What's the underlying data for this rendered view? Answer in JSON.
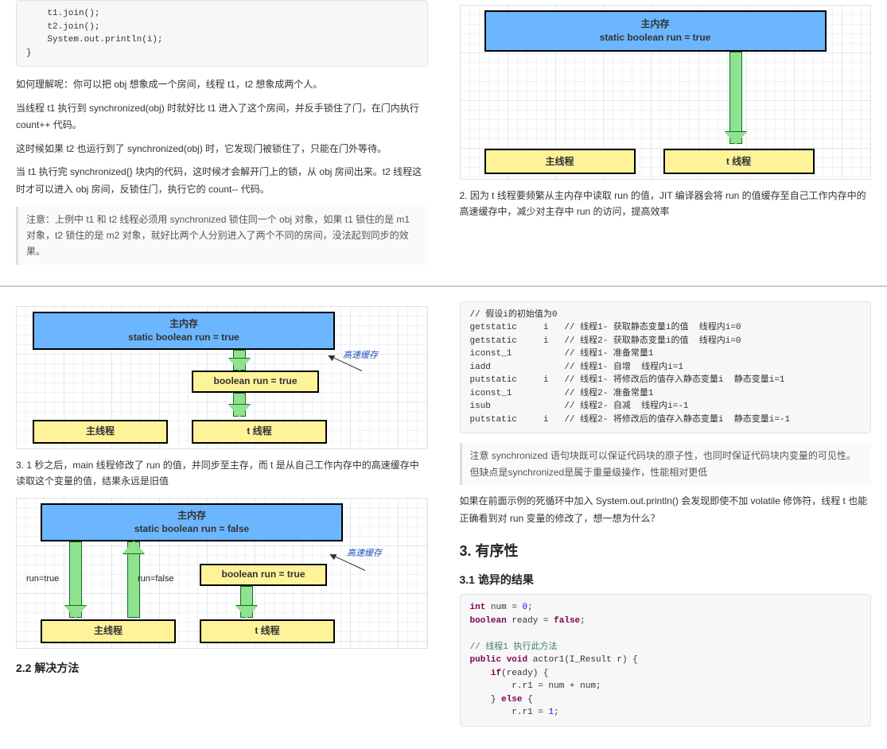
{
  "topLeft": {
    "code": "    t1.join();\n    t2.join();\n    System.out.println(i);\n}",
    "p1": "如何理解呢：你可以把 obj 想象成一个房间，线程 t1，t2 想象成两个人。",
    "p2": "当线程 t1 执行到 synchronized(obj) 时就好比 t1 进入了这个房间，并反手锁住了门，在门内执行 count++ 代码。",
    "p3": "这时候如果 t2 也运行到了 synchronized(obj) 时，它发现门被锁住了，只能在门外等待。",
    "p4": "当 t1 执行完 synchronized{} 块内的代码，这时候才会解开门上的锁，从 obj 房间出来。t2 线程这时才可以进入 obj 房间，反锁住门，执行它的 count-- 代码。",
    "note": "注意：上例中 t1 和 t2 线程必须用 synchronized 锁住同一个 obj 对象，如果 t1 锁住的是 m1 对象，t2 锁住的是 m2 对象，就好比两个人分别进入了两个不同的房间，没法起到同步的效果。"
  },
  "topRight": {
    "diagram1": {
      "memTitle": "主内存",
      "memSub": "static boolean run = true",
      "mainThread": "主线程",
      "tThread": "t 线程"
    },
    "caption": "2. 因为 t 线程要频繁从主内存中读取 run 的值，JIT 编译器会将 run 的值缓存至自己工作内存中的高速缓存中，减少对主存中 run 的访问，提高效率"
  },
  "bottomLeft": {
    "d2": {
      "memTitle": "主内存",
      "memSub": "static boolean run = true",
      "cacheLabel": "高速缓存",
      "cache": "boolean run = true",
      "mainThread": "主线程",
      "tThread": "t 线程"
    },
    "caption2": "3. 1 秒之后，main 线程修改了 run 的值，并同步至主存，而 t 是从自己工作内存中的高速缓存中读取这个变量的值，结果永远是旧值",
    "d3": {
      "memTitle": "主内存",
      "memSub": "static boolean run = false",
      "cacheLabel": "高速缓存",
      "cache": "boolean run = true",
      "mainThread": "主线程",
      "tThread": "t 线程",
      "runTrue": "run=true",
      "runFalse": "run=false"
    },
    "h22": "2.2 解决方法"
  },
  "bottomRight": {
    "bytecode": "// 假设i的初始值为0\ngetstatic     i   // 线程1- 获取静态变量i的值  线程内i=0\ngetstatic     i   // 线程2- 获取静态变量i的值  线程内i=0\niconst_1          // 线程1- 准备常量1\niadd              // 线程1- 自增  线程内i=1\nputstatic     i   // 线程1- 将修改后的值存入静态变量i  静态变量i=1\niconst_1          // 线程2- 准备常量1\nisub              // 线程2- 自减  线程内i=-1\nputstatic     i   // 线程2- 将修改后的值存入静态变量i  静态变量i=-1",
    "note1": "注意 synchronized 语句块既可以保证代码块的原子性，也同时保证代码块内变量的可见性。但缺点是synchronized是属于重量级操作，性能相对更低",
    "note2": "如果在前面示例的死循环中加入 System.out.println() 会发现即使不加 volatile 修饰符，线程 t 也能正确看到对 run 变量的修改了，想一想为什么？",
    "h3": "3. 有序性",
    "h31": "3.1 诡异的结果",
    "code2_lines": [
      {
        "t": "int",
        "c": "kw"
      },
      {
        "t": " num = "
      },
      {
        "t": "0",
        "c": "s"
      },
      {
        "t": ";\n"
      },
      {
        "t": "boolean",
        "c": "kw"
      },
      {
        "t": " ready = "
      },
      {
        "t": "false",
        "c": "kw"
      },
      {
        "t": ";\n\n"
      },
      {
        "t": "// 线程1 执行此方法\n",
        "c": "cm"
      },
      {
        "t": "public void",
        "c": "kw"
      },
      {
        "t": " actor1(I_Result r) {\n"
      },
      {
        "t": "    if",
        "c": "kw"
      },
      {
        "t": "(ready) {\n"
      },
      {
        "t": "        r.r1 = num + num;\n"
      },
      {
        "t": "    } "
      },
      {
        "t": "else",
        "c": "kw"
      },
      {
        "t": " {\n"
      },
      {
        "t": "        r.r1 = "
      },
      {
        "t": "1",
        "c": "s"
      },
      {
        "t": ";\n"
      }
    ]
  }
}
